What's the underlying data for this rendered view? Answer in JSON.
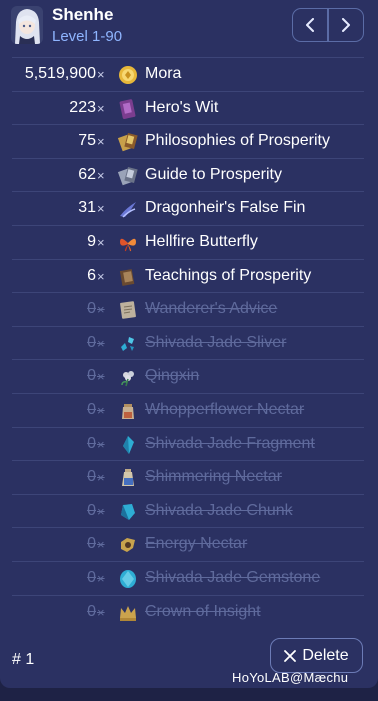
{
  "character": {
    "name": "Shenhe",
    "level": "Level 1-90"
  },
  "nav": {
    "prev_icon": "chevron-left-icon",
    "next_icon": "chevron-right-icon"
  },
  "materials": [
    {
      "qty": "5,519,900",
      "times": "×",
      "name": "Mora",
      "icon": "mora-coin-icon",
      "done": false
    },
    {
      "qty": "223",
      "times": "×",
      "name": "Hero's Wit",
      "icon": "heros-wit-book-icon",
      "done": false
    },
    {
      "qty": "75",
      "times": "×",
      "name": "Philosophies of Prosperity",
      "icon": "philosophies-icon",
      "done": false
    },
    {
      "qty": "62",
      "times": "×",
      "name": "Guide to Prosperity",
      "icon": "guide-icon",
      "done": false
    },
    {
      "qty": "31",
      "times": "×",
      "name": "Dragonheir's False Fin",
      "icon": "false-fin-icon",
      "done": false
    },
    {
      "qty": "9",
      "times": "×",
      "name": "Hellfire Butterfly",
      "icon": "butterfly-icon",
      "done": false
    },
    {
      "qty": "6",
      "times": "×",
      "name": "Teachings of Prosperity",
      "icon": "teachings-icon",
      "done": false
    },
    {
      "qty": "0",
      "times": "×",
      "name": "Wanderer's Advice",
      "icon": "wanderers-advice-icon",
      "done": true
    },
    {
      "qty": "0",
      "times": "×",
      "name": "Shivada Jade Sliver",
      "icon": "jade-sliver-icon",
      "done": true
    },
    {
      "qty": "0",
      "times": "×",
      "name": "Qingxin",
      "icon": "qingxin-flower-icon",
      "done": true
    },
    {
      "qty": "0",
      "times": "×",
      "name": "Whopperflower Nectar",
      "icon": "whopperflower-nectar-icon",
      "done": true
    },
    {
      "qty": "0",
      "times": "×",
      "name": "Shivada Jade Fragment",
      "icon": "jade-fragment-icon",
      "done": true
    },
    {
      "qty": "0",
      "times": "×",
      "name": "Shimmering Nectar",
      "icon": "shimmering-nectar-icon",
      "done": true
    },
    {
      "qty": "0",
      "times": "×",
      "name": "Shivada Jade Chunk",
      "icon": "jade-chunk-icon",
      "done": true
    },
    {
      "qty": "0",
      "times": "×",
      "name": "Energy Nectar",
      "icon": "energy-nectar-icon",
      "done": true
    },
    {
      "qty": "0",
      "times": "×",
      "name": "Shivada Jade Gemstone",
      "icon": "jade-gemstone-icon",
      "done": true
    },
    {
      "qty": "0",
      "times": "×",
      "name": "Crown of Insight",
      "icon": "crown-icon",
      "done": true
    }
  ],
  "footer": {
    "index": "# 1",
    "delete_label": "Delete",
    "watermark": "HoYoLAB@Mæchu"
  },
  "colors": {
    "background": "#1e2245",
    "card": "#2b3162",
    "accent": "#8fb5ff",
    "done_text": "#5f6a9c"
  }
}
